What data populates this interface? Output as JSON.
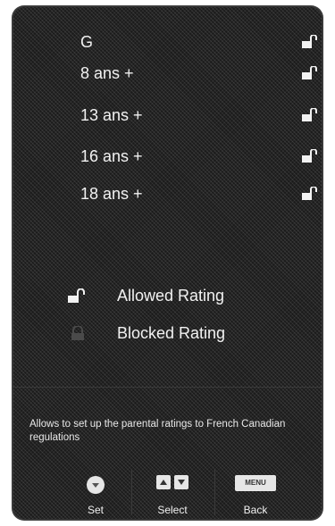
{
  "ratings": [
    {
      "label": "G",
      "state": "allowed"
    },
    {
      "label": "8 ans +",
      "state": "allowed"
    },
    {
      "label": "13 ans +",
      "state": "allowed"
    },
    {
      "label": "16 ans +",
      "state": "allowed"
    },
    {
      "label": "18 ans +",
      "state": "allowed"
    }
  ],
  "legend": {
    "allowed_label": "Allowed Rating",
    "blocked_label": "Blocked Rating",
    "allowed_icon": "unlocked-padlock-icon",
    "blocked_icon": "locked-padlock-icon"
  },
  "help_text": "Allows to set up the parental ratings to French Canadian regulations",
  "footer": {
    "set_label": "Set",
    "select_label": "Select",
    "back_label": "Back",
    "menu_key_label": "MENU"
  },
  "colors": {
    "panel_background": "#1b1b1b",
    "text": "#f2f2f2"
  }
}
